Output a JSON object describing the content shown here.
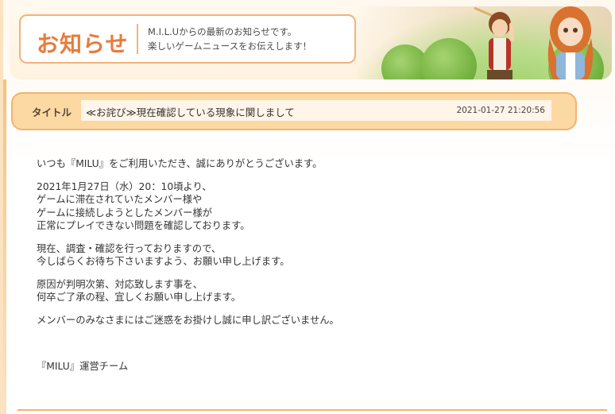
{
  "header": {
    "title": "お知らせ",
    "subtitle_line1": "M.I.L.Uからの最新のお知らせです。",
    "subtitle_line2": "楽しいゲームニュースをお伝えします！"
  },
  "notice": {
    "label": "タイトル",
    "title": "≪お詫び≫現在確認している現象に関しまして",
    "datetime": "2021-01-27 21:20:56"
  },
  "body": {
    "p1": [
      "いつも『MILU』をご利用いただき、誠にありがとうございます。"
    ],
    "p2": [
      "2021年1月27日（水）20：10頃より、",
      "ゲームに滞在されていたメンバー様や",
      "ゲームに接続しようとしたメンバー様が",
      "正常にプレイできない問題を確認しております。"
    ],
    "p3": [
      "現在、調査・確認を行っておりますので、",
      "今しばらくお待ち下さいますよう、お願い申し上げます。"
    ],
    "p4": [
      "原因が判明次第、対応致します事を、",
      "何卒ご了承の程、宜しくお願い申し上げます。"
    ],
    "p5": [
      "メンバーのみなさまにはご迷惑をお掛けし誠に申し訳ございません。"
    ],
    "signature": "『MILU』運営チーム"
  },
  "colors": {
    "accent": "#e77c3c",
    "frame": "#f3b36b",
    "bar": "#fcd9a3"
  }
}
